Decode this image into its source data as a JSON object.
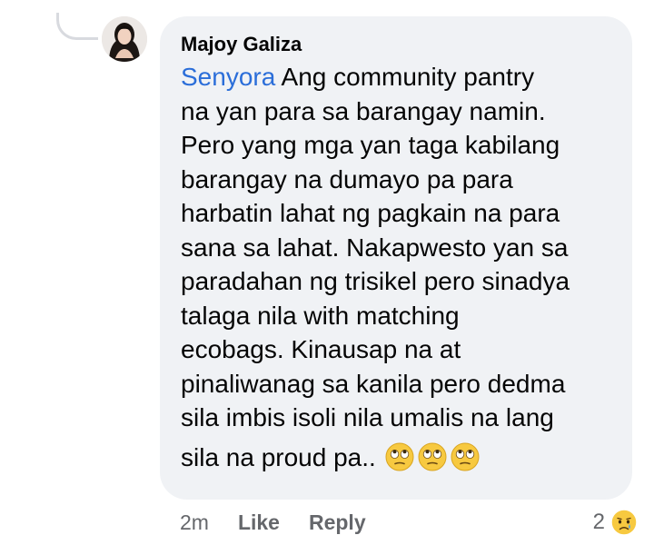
{
  "comment": {
    "author": "Majoy Galiza",
    "mention": "Senyora",
    "lines": [
      "Ang community pantry",
      "na yan para sa barangay namin.",
      "Pero yang mga yan taga kabilang",
      "barangay na dumayo pa para",
      "harbatin lahat ng pagkain na para",
      "sana sa lahat. Nakapwesto yan sa",
      "paradahan ng trisikel pero sinadya",
      "talaga nila with matching",
      "ecobags. Kinausap na at",
      "pinaliwanag sa kanila pero dedma",
      "sila imbis isoli nila umalis na lang"
    ],
    "last_line": "sila na proud pa..",
    "trailing_emoji": [
      "rolling-eyes",
      "rolling-eyes",
      "rolling-eyes"
    ]
  },
  "actions": {
    "time": "2m",
    "like_label": "Like",
    "reply_label": "Reply"
  },
  "reactions": {
    "count": "2",
    "type": "sad"
  },
  "colors": {
    "bubble": "#f0f2f5",
    "mention": "#2b6ed9",
    "text": "#050505",
    "secondary": "#65676b"
  }
}
